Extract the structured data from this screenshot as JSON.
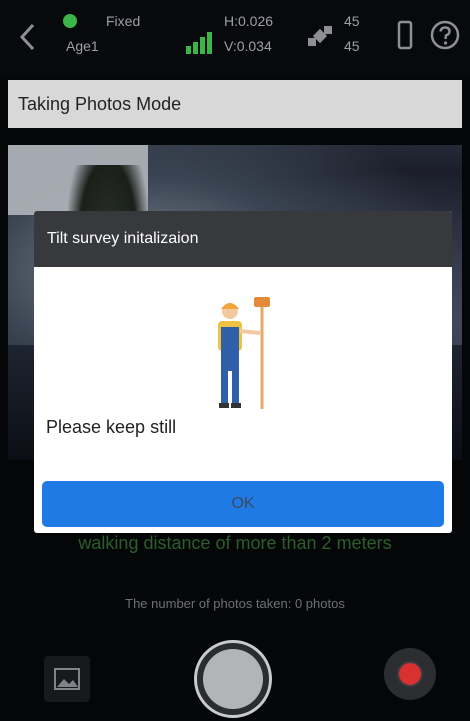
{
  "status": {
    "fixed_label": "Fixed",
    "age_label": "Age1",
    "sats_top": "45",
    "sats_bottom": "45",
    "hrms_label": "H:0.026",
    "vrms_label": "V:0.034",
    "colors": {
      "fixed": "#3bb54a",
      "signal": "#3bb54a",
      "text": "#9aa0a5"
    }
  },
  "mode_bar": {
    "label": "Taking Photos Mode"
  },
  "dialog": {
    "title": "Tilt survey initalizaion",
    "message": "Please keep still",
    "ok_label": "OK",
    "accent": "#1f7ae6"
  },
  "hints": {
    "walking": "walking distance of more than 2 meters",
    "photo_count": "The number of photos taken: 0 photos"
  },
  "icons": [
    "back-icon",
    "satellite-fix-icon",
    "signal-bars-icon",
    "satellite-icon",
    "device-icon",
    "help-icon",
    "gallery-icon",
    "record-icon"
  ]
}
